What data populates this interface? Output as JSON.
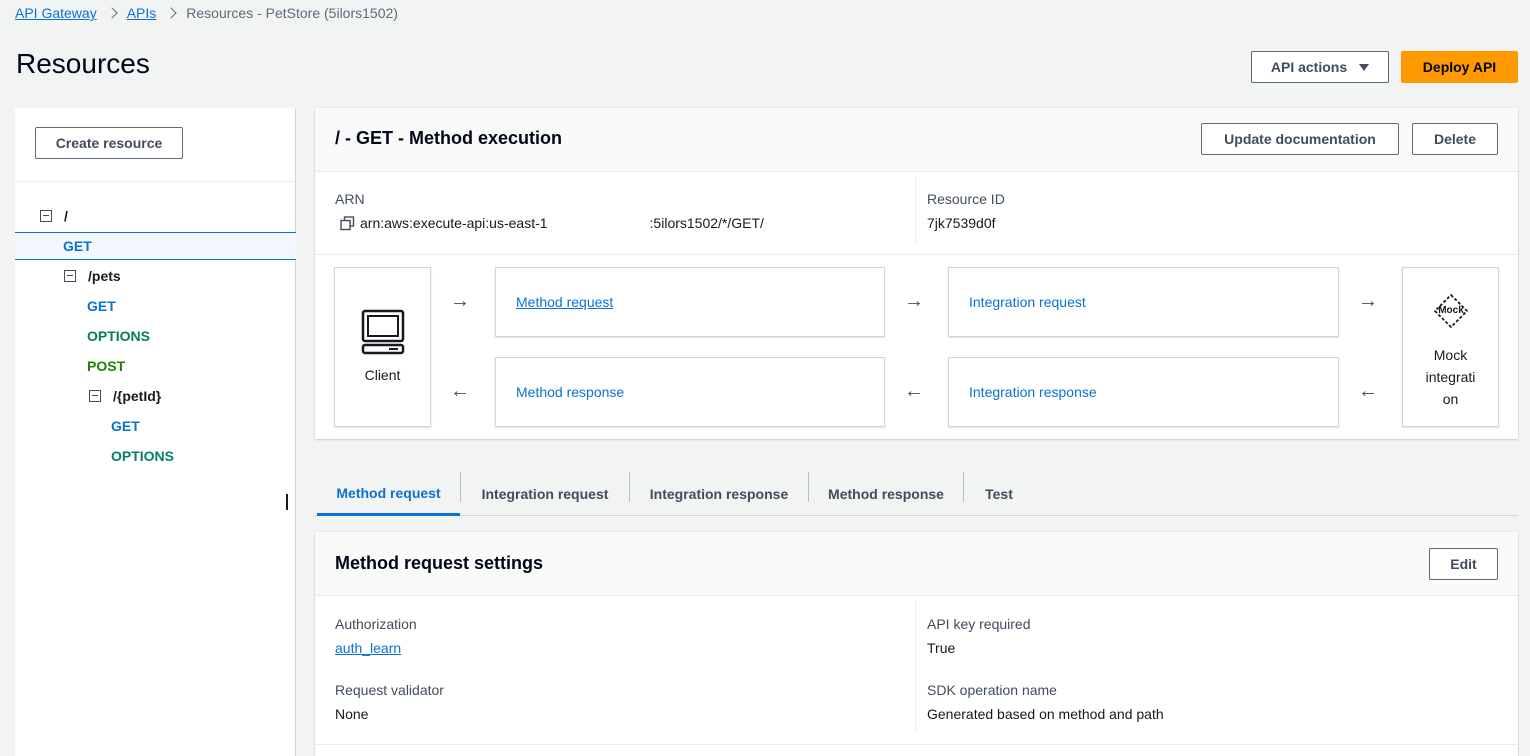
{
  "breadcrumb": {
    "items": [
      "API Gateway",
      "APIs"
    ],
    "current": "Resources - PetStore (5ilors1502)"
  },
  "page": {
    "title": "Resources",
    "api_actions_label": "API actions",
    "deploy_label": "Deploy API"
  },
  "sidebar": {
    "create_resource_label": "Create resource",
    "tree": [
      {
        "label": "/",
        "kind": "resource"
      },
      {
        "label": "GET",
        "kind": "method",
        "selected": true
      },
      {
        "label": "/pets",
        "kind": "resource"
      },
      {
        "label": "GET",
        "kind": "method"
      },
      {
        "label": "OPTIONS",
        "kind": "method"
      },
      {
        "label": "POST",
        "kind": "method"
      },
      {
        "label": "/{petId}",
        "kind": "resource"
      },
      {
        "label": "GET",
        "kind": "method"
      },
      {
        "label": "OPTIONS",
        "kind": "method"
      }
    ]
  },
  "method_execution": {
    "title": "/ - GET - Method execution",
    "update_doc_label": "Update documentation",
    "delete_label": "Delete",
    "arn_label": "ARN",
    "arn_value_part1": "arn:aws:execute-api:us-east-1",
    "arn_value_part2": ":5ilors1502/*/GET/",
    "resource_id_label": "Resource ID",
    "resource_id_value": "7jk7539d0f",
    "client_label": "Client",
    "method_request_label": "Method request",
    "integration_request_label": "Integration request",
    "method_response_label": "Method response",
    "integration_response_label": "Integration response",
    "mock_badge": "Mock",
    "mock_label_lines": [
      "Mock",
      "integrati",
      "on"
    ]
  },
  "tabs": [
    {
      "label": "Method request",
      "active": true
    },
    {
      "label": "Integration request"
    },
    {
      "label": "Integration response"
    },
    {
      "label": "Method response"
    },
    {
      "label": "Test"
    }
  ],
  "settings": {
    "title": "Method request settings",
    "edit_label": "Edit",
    "authorization_label": "Authorization",
    "authorization_value": "auth_learn",
    "api_key_label": "API key required",
    "api_key_value": "True",
    "validator_label": "Request validator",
    "validator_value": "None",
    "sdk_label": "SDK operation name",
    "sdk_value": "Generated based on method and path"
  },
  "colors": {
    "link": "#0972d3",
    "primary_button": "#ff9900",
    "options_method": "#037f51",
    "post_method": "#1d8102"
  }
}
